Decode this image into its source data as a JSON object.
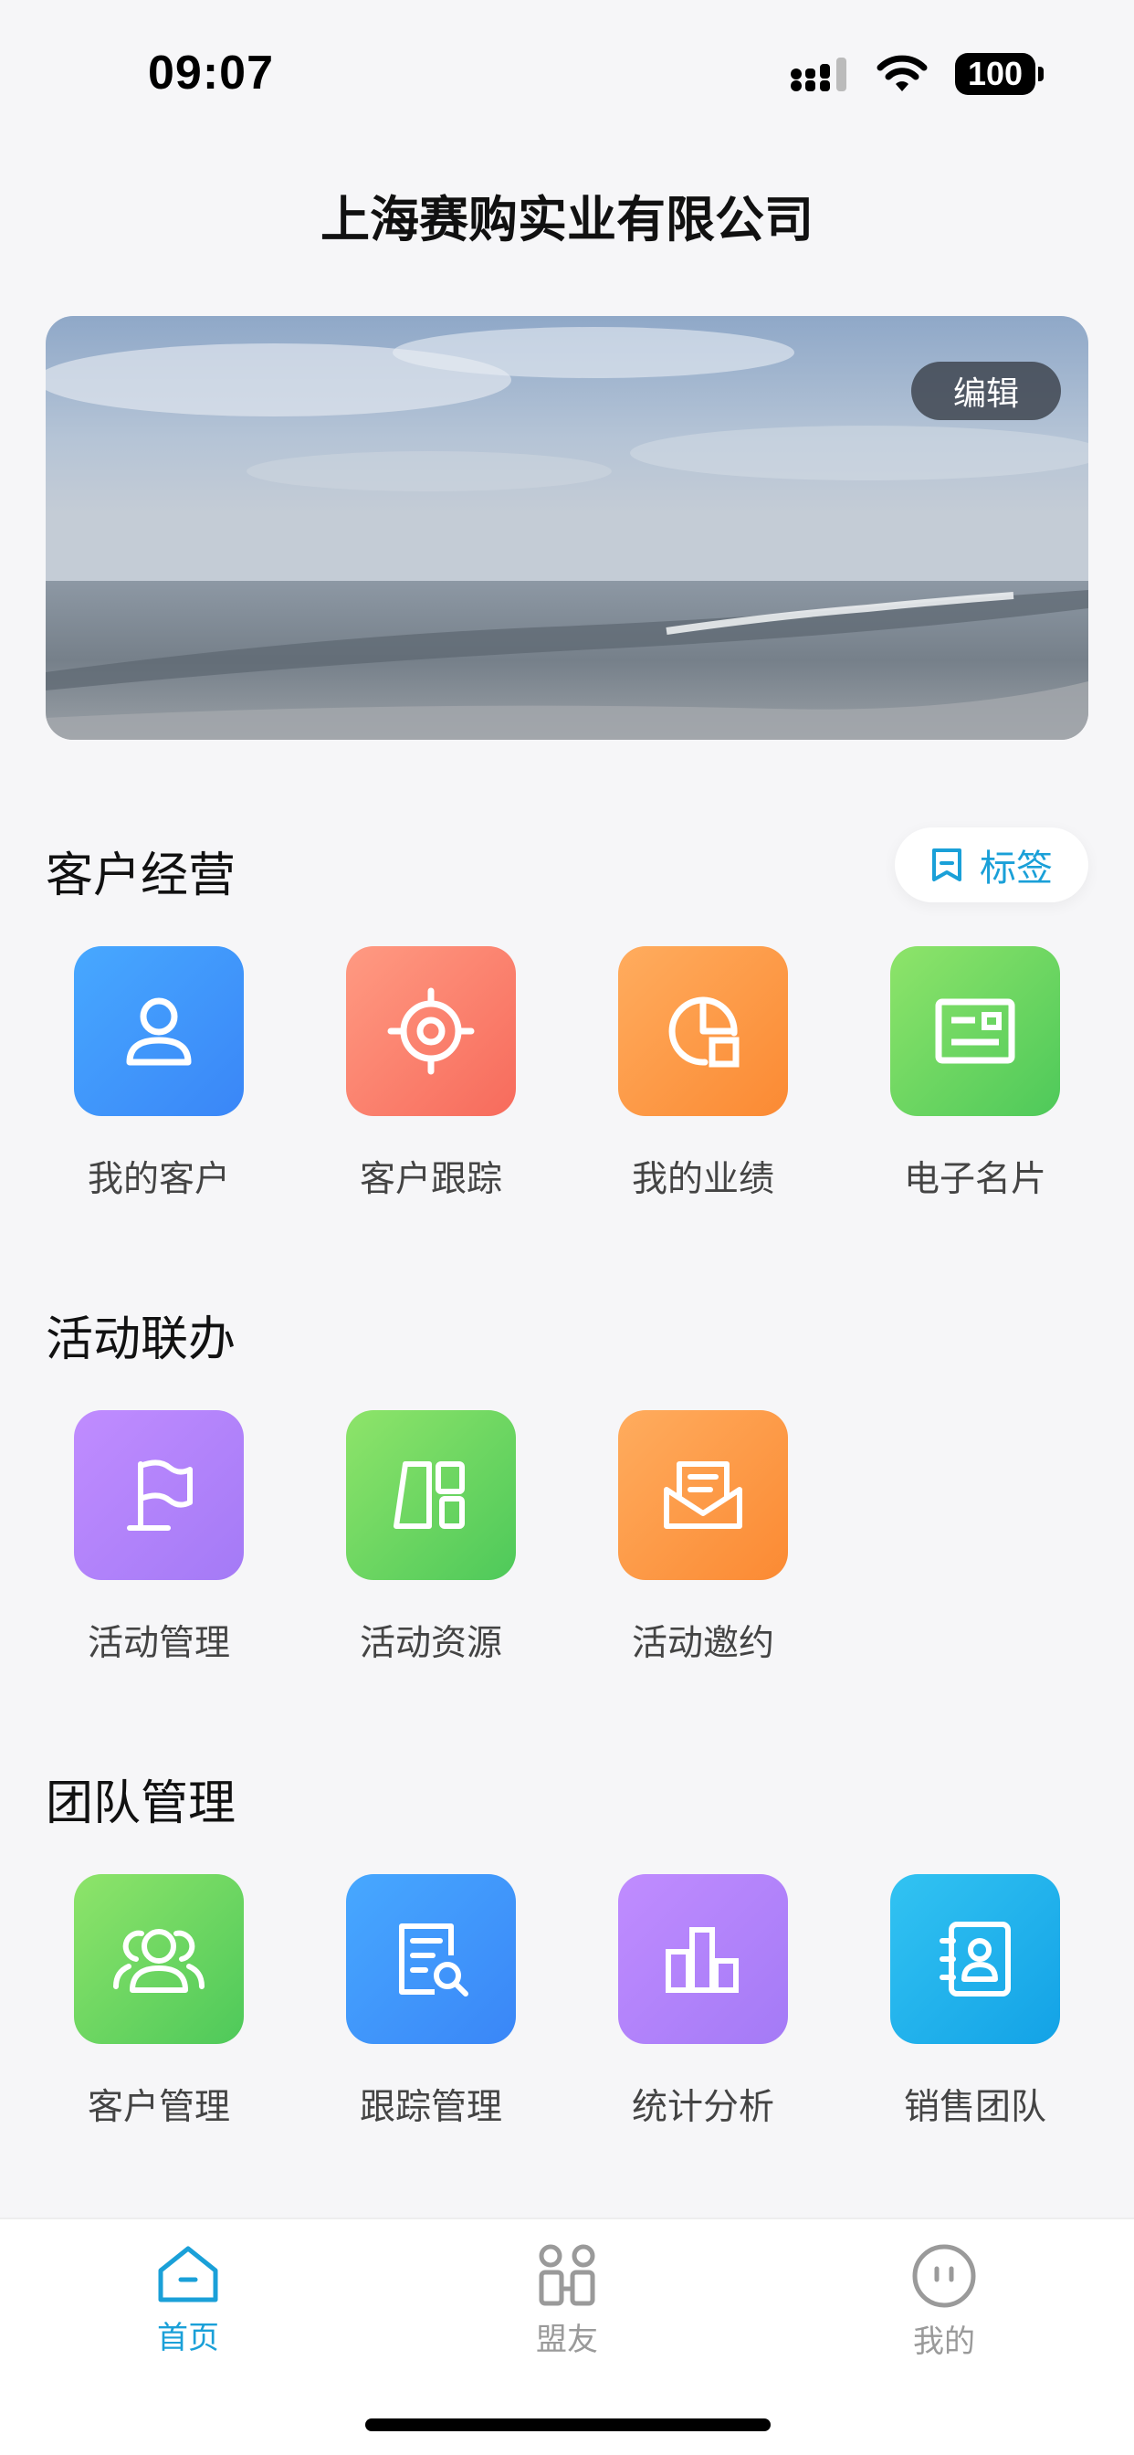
{
  "status_bar": {
    "time": "09:07",
    "battery": "100"
  },
  "header": {
    "title": "上海赛购实业有限公司"
  },
  "banner": {
    "edit_label": "编辑"
  },
  "sections": {
    "customer": {
      "title": "客户经营",
      "tag_label": "标签",
      "items": [
        {
          "label": "我的客户",
          "icon": "user-icon",
          "color": "#3f97fb"
        },
        {
          "label": "客户跟踪",
          "icon": "target-icon",
          "color": "#fa7f6c"
        },
        {
          "label": "我的业绩",
          "icon": "performance-chart-icon",
          "color": "#fd9744"
        },
        {
          "label": "电子名片",
          "icon": "business-card-icon",
          "color": "#5fd25e"
        }
      ]
    },
    "activity": {
      "title": "活动联办",
      "items": [
        {
          "label": "活动管理",
          "icon": "flag-icon",
          "color": "#b283fb"
        },
        {
          "label": "活动资源",
          "icon": "resource-blocks-icon",
          "color": "#5fd25e"
        },
        {
          "label": "活动邀约",
          "icon": "invitation-envelope-icon",
          "color": "#fd9744"
        }
      ]
    },
    "team": {
      "title": "团队管理",
      "items": [
        {
          "label": "客户管理",
          "icon": "users-group-icon",
          "color": "#5fd25e"
        },
        {
          "label": "跟踪管理",
          "icon": "document-search-icon",
          "color": "#3f97fb"
        },
        {
          "label": "统计分析",
          "icon": "bar-chart-icon",
          "color": "#b283fb"
        },
        {
          "label": "销售团队",
          "icon": "contact-book-icon",
          "color": "#1fb0ec"
        }
      ]
    }
  },
  "tabbar": {
    "items": [
      {
        "label": "首页",
        "icon": "home-icon",
        "active": true
      },
      {
        "label": "盟友",
        "icon": "allies-grid-icon",
        "active": false
      },
      {
        "label": "我的",
        "icon": "profile-face-icon",
        "active": false
      }
    ],
    "active_color": "#1aa0d8"
  }
}
